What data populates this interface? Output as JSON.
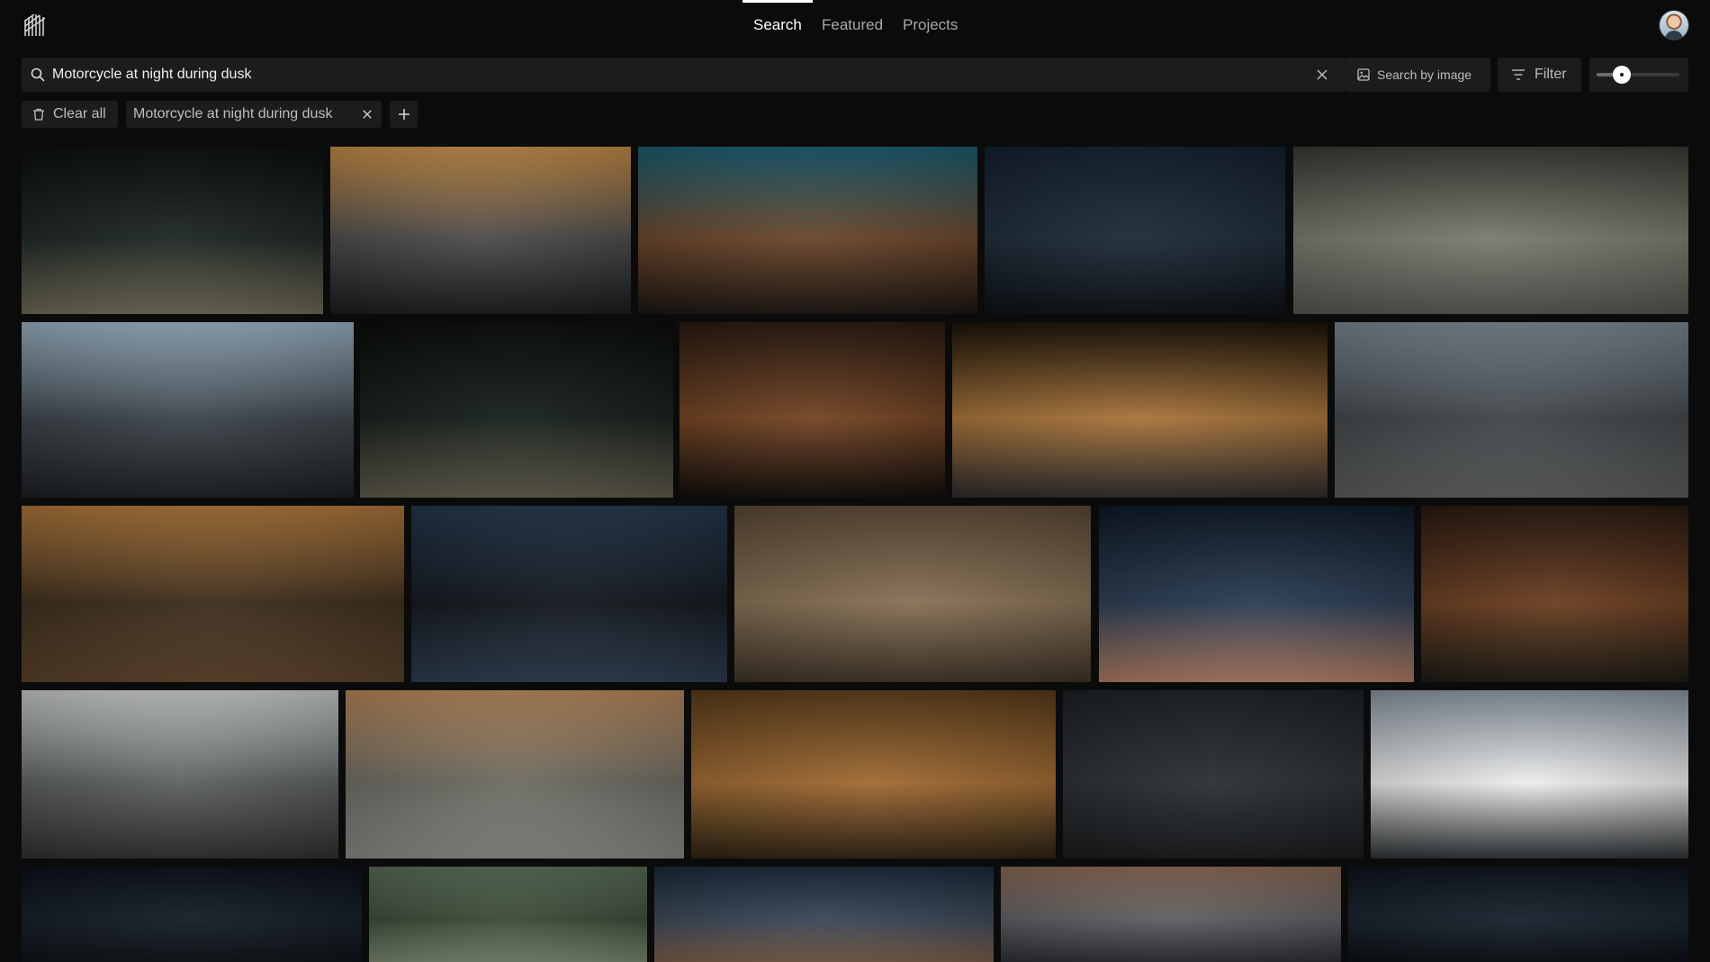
{
  "nav": {
    "tabs": [
      {
        "label": "Search",
        "active": true
      },
      {
        "label": "Featured",
        "active": false
      },
      {
        "label": "Projects",
        "active": false
      }
    ]
  },
  "search": {
    "query": "Motorcycle at night during dusk",
    "search_by_image_label": "Search by image",
    "filter_label": "Filter",
    "zoom_level": 0.3
  },
  "chips": {
    "clear_all_label": "Clear all",
    "active_query": "Motorcycle at night during dusk"
  },
  "icons": {
    "logo": "logo-icon",
    "search": "search-icon",
    "clear": "close-icon",
    "image": "image-icon",
    "filter": "filter-icon",
    "trash": "trash-icon",
    "add": "plus-icon"
  },
  "results": [
    {
      "id": "r1",
      "colors": [
        "#0b0f0d",
        "#1d2622",
        "#6f6a56"
      ]
    },
    {
      "id": "r2",
      "colors": [
        "#c89048",
        "#4b4a4c",
        "#1a1a1d"
      ]
    },
    {
      "id": "r3",
      "colors": [
        "#1b5e73",
        "#6a4529",
        "#1a1410"
      ]
    },
    {
      "id": "r4",
      "colors": [
        "#142131",
        "#1d2b38",
        "#0c1015"
      ]
    },
    {
      "id": "r5",
      "colors": [
        "#3a3b34",
        "#7b7a70",
        "#51544d"
      ]
    },
    {
      "id": "r6",
      "colors": [
        "#9fb6c8",
        "#3b4349",
        "#1b1e21"
      ]
    },
    {
      "id": "r7",
      "colors": [
        "#0a0d0c",
        "#17201b",
        "#5f5a4a"
      ]
    },
    {
      "id": "r8",
      "colors": [
        "#2a1a12",
        "#734422",
        "#0f0c0a"
      ]
    },
    {
      "id": "r9",
      "colors": [
        "#1a1308",
        "#a8743a",
        "#2b2a2c"
      ]
    },
    {
      "id": "r10",
      "colors": [
        "#7c8a93",
        "#3f4448",
        "#5b5d5b"
      ]
    },
    {
      "id": "r11",
      "colors": [
        "#b17a3c",
        "#3b2c1c",
        "#5a4128"
      ]
    },
    {
      "id": "r12",
      "colors": [
        "#25384e",
        "#12161c",
        "#2c3c4f"
      ]
    },
    {
      "id": "r13",
      "colors": [
        "#5c4a36",
        "#877055",
        "#3c3226"
      ]
    },
    {
      "id": "r14",
      "colors": [
        "#0e1a26",
        "#2a3c52",
        "#b07d62"
      ]
    },
    {
      "id": "r15",
      "colors": [
        "#2a1a12",
        "#6b3e20",
        "#1b1a14"
      ]
    },
    {
      "id": "r16",
      "colors": [
        "#cfd2d2",
        "#5c605f",
        "#2f2f2d"
      ]
    },
    {
      "id": "r17",
      "colors": [
        "#b98a5c",
        "#6b6a62",
        "#8a8a84"
      ]
    },
    {
      "id": "r18",
      "colors": [
        "#5a3d1a",
        "#a06a32",
        "#2c2214"
      ]
    },
    {
      "id": "r19",
      "colors": [
        "#1d2126",
        "#2b2f33",
        "#17191b"
      ]
    },
    {
      "id": "r20",
      "colors": [
        "#8b97a3",
        "#ededeb",
        "#2d3134"
      ]
    },
    {
      "id": "r21",
      "colors": [
        "#0b1118",
        "#141c26",
        "#0e1217"
      ]
    },
    {
      "id": "r22",
      "colors": [
        "#5a6e58",
        "#3a4a36",
        "#7a8870"
      ]
    },
    {
      "id": "r23",
      "colors": [
        "#1b2a3b",
        "#3a4656",
        "#7a5e4a"
      ]
    },
    {
      "id": "r24",
      "colors": [
        "#8a6a56",
        "#5e5e62",
        "#2c2e33"
      ]
    },
    {
      "id": "r25",
      "colors": [
        "#0d141b",
        "#17212c",
        "#0b0f14"
      ]
    }
  ]
}
